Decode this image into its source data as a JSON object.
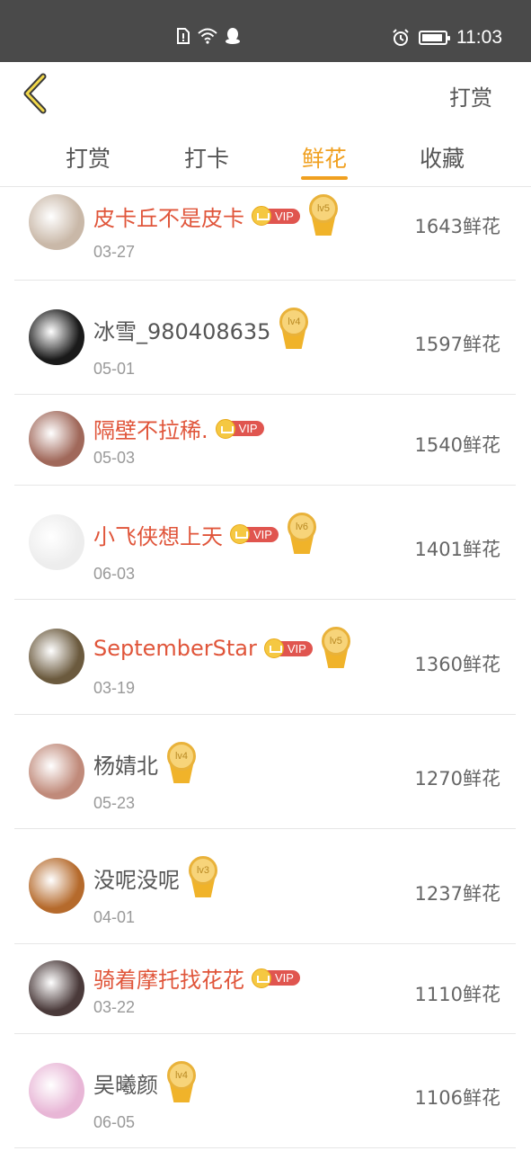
{
  "status_bar": {
    "time": "11:03",
    "icons": [
      "sim-alert-icon",
      "wifi-icon",
      "qq-icon",
      "alarm-icon",
      "battery-icon"
    ],
    "battery_level": 0.9
  },
  "header": {
    "back_icon": "chevron-left-icon",
    "action_label": "打赏"
  },
  "tabs": [
    {
      "label": "打赏",
      "active": false
    },
    {
      "label": "打卡",
      "active": false
    },
    {
      "label": "鲜花",
      "active": true
    },
    {
      "label": "收藏",
      "active": false
    }
  ],
  "colors": {
    "accent": "#f0a020",
    "vip_name": "#e0553a",
    "normal_name": "#555555",
    "vip_badge": "#e0554f"
  },
  "list": [
    {
      "name": "皮卡丘不是皮卡",
      "vip": true,
      "level": "lv5",
      "date": "03-27",
      "count": "1643鲜花",
      "avatar_color": "#c9b8a8"
    },
    {
      "name": "冰雪_980408635",
      "vip": false,
      "level": "lv4",
      "date": "05-01",
      "count": "1597鲜花",
      "avatar_color": "#1a1a1a"
    },
    {
      "name": "隔壁不拉稀.",
      "vip": true,
      "level": "",
      "date": "05-03",
      "count": "1540鲜花",
      "avatar_color": "#a0685a"
    },
    {
      "name": "小飞侠想上天",
      "vip": true,
      "level": "lv6",
      "date": "06-03",
      "count": "1401鲜花",
      "avatar_color": "#ededed"
    },
    {
      "name": "SeptemberStar",
      "vip": true,
      "level": "lv5",
      "date": "03-19",
      "count": "1360鲜花",
      "avatar_color": "#6b5a3e"
    },
    {
      "name": "杨婧北",
      "vip": false,
      "level": "lv4",
      "date": "05-23",
      "count": "1270鲜花",
      "avatar_color": "#c08a7a"
    },
    {
      "name": "没呢没呢",
      "vip": false,
      "level": "lv3",
      "date": "04-01",
      "count": "1237鲜花",
      "avatar_color": "#b56a2c"
    },
    {
      "name": "骑着摩托找花花",
      "vip": true,
      "level": "",
      "date": "03-22",
      "count": "1110鲜花",
      "avatar_color": "#4a3a3a"
    },
    {
      "name": "吴曦颜",
      "vip": false,
      "level": "lv4",
      "date": "06-05",
      "count": "1106鲜花",
      "avatar_color": "#e8b6d6"
    }
  ],
  "vip_label": "VIP"
}
